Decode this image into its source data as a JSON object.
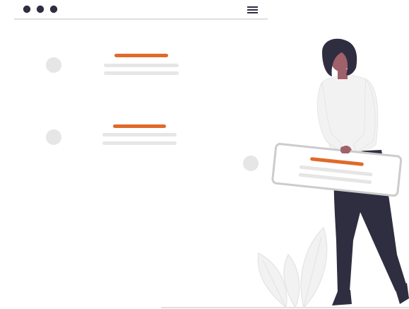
{
  "colors": {
    "accent": "#e06a2a",
    "dark": "#2f2e41",
    "placeholder": "#e6e6e6",
    "line": "#cccccc",
    "shirt": "#f2f2f2",
    "skin": "#a0616a",
    "hair": "#2f2e41"
  },
  "window_dots": [
    "dot-1",
    "dot-2",
    "dot-3"
  ],
  "cards": [
    {
      "name": "card-1"
    },
    {
      "name": "card-2"
    },
    {
      "name": "card-3-held"
    }
  ],
  "icons": {
    "menu": "hamburger-menu-icon",
    "window_controls": "window-dots-icon"
  }
}
